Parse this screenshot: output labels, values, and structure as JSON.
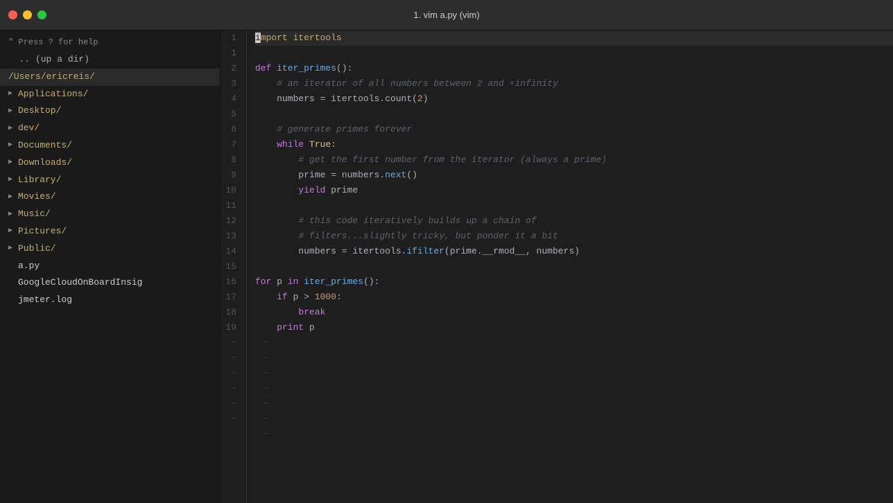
{
  "titlebar": {
    "title": "1. vim a.py (vim)",
    "controls": {
      "close_label": "",
      "min_label": "",
      "max_label": ""
    }
  },
  "sidebar": {
    "header": "\" Press ? for help",
    "items": [
      {
        "id": "parent-dir",
        "label": ".. (up a dir)",
        "type": "parent"
      },
      {
        "id": "current-dir",
        "label": "/Users/ericreis/",
        "type": "current"
      },
      {
        "id": "applications",
        "label": "Applications/",
        "type": "folder"
      },
      {
        "id": "desktop",
        "label": "Desktop/",
        "type": "folder"
      },
      {
        "id": "dev",
        "label": "dev/",
        "type": "folder"
      },
      {
        "id": "documents",
        "label": "Documents/",
        "type": "folder"
      },
      {
        "id": "downloads",
        "label": "Downloads/",
        "type": "folder"
      },
      {
        "id": "library",
        "label": "Library/",
        "type": "folder"
      },
      {
        "id": "movies",
        "label": "Movies/",
        "type": "folder"
      },
      {
        "id": "music",
        "label": "Music/",
        "type": "folder"
      },
      {
        "id": "pictures",
        "label": "Pictures/",
        "type": "folder"
      },
      {
        "id": "public",
        "label": "Public/",
        "type": "folder"
      },
      {
        "id": "a-py",
        "label": "a.py",
        "type": "file"
      },
      {
        "id": "google-cloud",
        "label": "GoogleCloudOnBoardInsig",
        "type": "file"
      },
      {
        "id": "jmeter-log",
        "label": "jmeter.log",
        "type": "file"
      }
    ]
  },
  "code": {
    "lines": [
      {
        "num": "1",
        "content": "import itertools",
        "type": "import_line"
      },
      {
        "num": "2",
        "content": "def iter_primes():",
        "type": "def_line"
      },
      {
        "num": "3",
        "content": "    # an iterator of all numbers between 2 and +infinity",
        "type": "comment"
      },
      {
        "num": "4",
        "content": "    numbers = itertools.count(2)",
        "type": "code"
      },
      {
        "num": "5",
        "content": "",
        "type": "empty"
      },
      {
        "num": "6",
        "content": "    # generate primes forever",
        "type": "comment"
      },
      {
        "num": "7",
        "content": "    while True:",
        "type": "code"
      },
      {
        "num": "8",
        "content": "        # get the first number from the iterator (always a prime)",
        "type": "comment"
      },
      {
        "num": "9",
        "content": "        prime = numbers.next()",
        "type": "code"
      },
      {
        "num": "10",
        "content": "        yield prime",
        "type": "code"
      },
      {
        "num": "11",
        "content": "",
        "type": "empty"
      },
      {
        "num": "12",
        "content": "        # this code iteratively builds up a chain of",
        "type": "comment"
      },
      {
        "num": "13",
        "content": "        # filters...slightly tricky, but ponder it a bit",
        "type": "comment"
      },
      {
        "num": "14",
        "content": "        numbers = itertools.ifilter(prime.__rmod__, numbers)",
        "type": "code"
      },
      {
        "num": "15",
        "content": "",
        "type": "empty"
      },
      {
        "num": "16",
        "content": "for p in iter_primes():",
        "type": "code"
      },
      {
        "num": "17",
        "content": "    if p > 1000:",
        "type": "code"
      },
      {
        "num": "18",
        "content": "        break",
        "type": "code"
      },
      {
        "num": "19",
        "content": "    print p",
        "type": "code"
      }
    ],
    "tildes": [
      "~",
      "~",
      "~",
      "~",
      "~",
      "~",
      "~"
    ],
    "status_line": "~"
  },
  "colors": {
    "bg": "#1e1e1e",
    "sidebar_bg": "#1a1a1a",
    "titlebar_bg": "#2d2d2d",
    "keyword": "#c678dd",
    "function": "#61afef",
    "comment": "#5c6370",
    "string": "#98c379",
    "number": "#d19a66",
    "folder_color": "#c8ae6e",
    "tilde": "#444"
  }
}
